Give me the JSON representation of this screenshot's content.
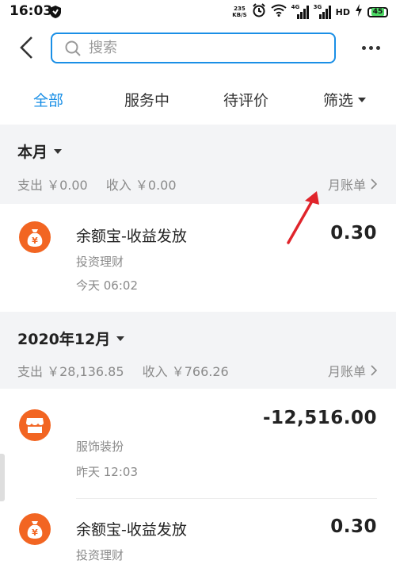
{
  "status_bar": {
    "time": "16:03",
    "net_speed_value": "235",
    "net_speed_unit": "KB/S",
    "signal1_tag": "4G",
    "signal2_tag": "3G",
    "hd_label": "HD",
    "battery": "45"
  },
  "search": {
    "placeholder": "搜索"
  },
  "tabs": [
    {
      "label": "全部",
      "active": true
    },
    {
      "label": "服务中"
    },
    {
      "label": "待评价"
    },
    {
      "label": "筛选"
    }
  ],
  "months": [
    {
      "title": "本月",
      "expense": "支出 ￥0.00",
      "income": "收入 ￥0.00",
      "bill_link": "月账单"
    },
    {
      "title": "2020年12月",
      "expense": "支出 ￥28,136.85",
      "income": "收入 ￥766.26",
      "bill_link": "月账单"
    }
  ],
  "transactions": [
    {
      "title": "余额宝-收益发放",
      "category": "投资理财",
      "time": "今天  06:02",
      "amount": "0.30",
      "icon": "money-bag-icon"
    },
    {
      "title": "",
      "category": "服饰装扮",
      "time": "昨天  12:03",
      "amount": "-12,516.00",
      "icon": "shop-icon"
    },
    {
      "title": "余额宝-收益发放",
      "category": "投资理财",
      "time": "",
      "amount": "0.30",
      "icon": "money-bag-icon"
    }
  ],
  "colors": {
    "accent": "#1a8fe6",
    "icon_orange": "#f26522",
    "annotation_arrow": "#e0242b"
  }
}
